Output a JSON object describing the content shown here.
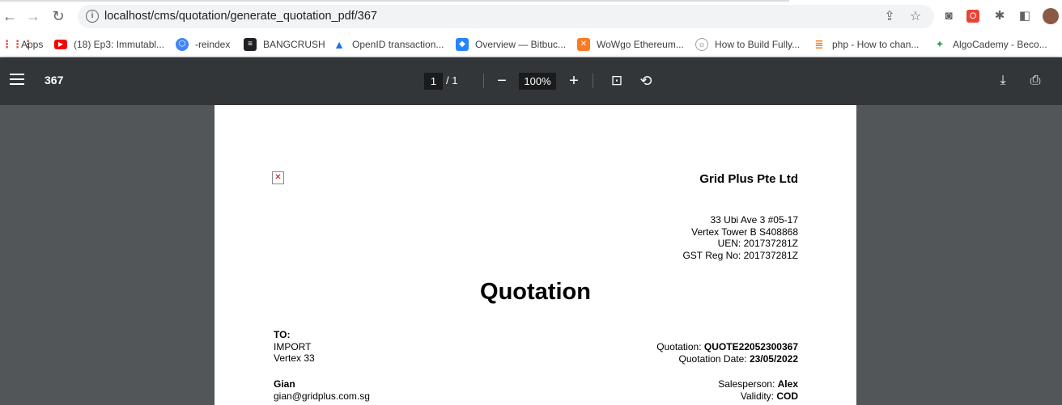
{
  "browser": {
    "url": "localhost/cms/quotation/generate_quotation_pdf/367",
    "bookmarks": [
      {
        "label": "Apps",
        "icon": "apps-grid-icon",
        "color": "#ea4335"
      },
      {
        "label": "(18) Ep3: Immutabl...",
        "icon": "youtube-icon",
        "color": "#ff0000"
      },
      {
        "label": "-reindex",
        "icon": "hexagon-icon",
        "color": "#4285f4"
      },
      {
        "label": "BANGCRUSH",
        "icon": "bangcrush-icon",
        "color": "#202124"
      },
      {
        "label": "OpenID transaction...",
        "icon": "openid-icon",
        "color": "#1a73e8"
      },
      {
        "label": "Overview — Bitbuc...",
        "icon": "bitbucket-icon",
        "color": "#2684ff"
      },
      {
        "label": "WoWgo Ethereum...",
        "icon": "xampp-icon",
        "color": "#fb7a24"
      },
      {
        "label": "How to Build Fully...",
        "icon": "site-icon",
        "color": "#5f6368"
      },
      {
        "label": "php - How to chan...",
        "icon": "stackoverflow-icon",
        "color": "#f48024"
      },
      {
        "label": "AlgoCademy - Beco...",
        "icon": "algocademy-icon",
        "color": "#34a853"
      }
    ]
  },
  "pdf": {
    "title": "367",
    "page_current": "1",
    "page_total": "/ 1",
    "zoom": "100%"
  },
  "document": {
    "company": "Grid Plus Pte Ltd",
    "address_lines": [
      "33 Ubi Ave 3 #05-17",
      "Vertex Tower B S408868",
      "UEN: 201737281Z",
      "GST Reg No: 201737281Z"
    ],
    "title": "Quotation",
    "to_label": "TO:",
    "to_lines": [
      "IMPORT",
      "Vertex 33"
    ],
    "quotation_label": "Quotation: ",
    "quotation_no": "QUOTE22052300367",
    "quotation_date_label": "Quotation Date: ",
    "quotation_date": "23/05/2022",
    "contact_name": "Gian",
    "contact_email": "gian@gridplus.com.sg",
    "salesperson_label": "Salesperson: ",
    "salesperson": "Alex",
    "validity_label": "Validity: ",
    "validity": "COD"
  }
}
